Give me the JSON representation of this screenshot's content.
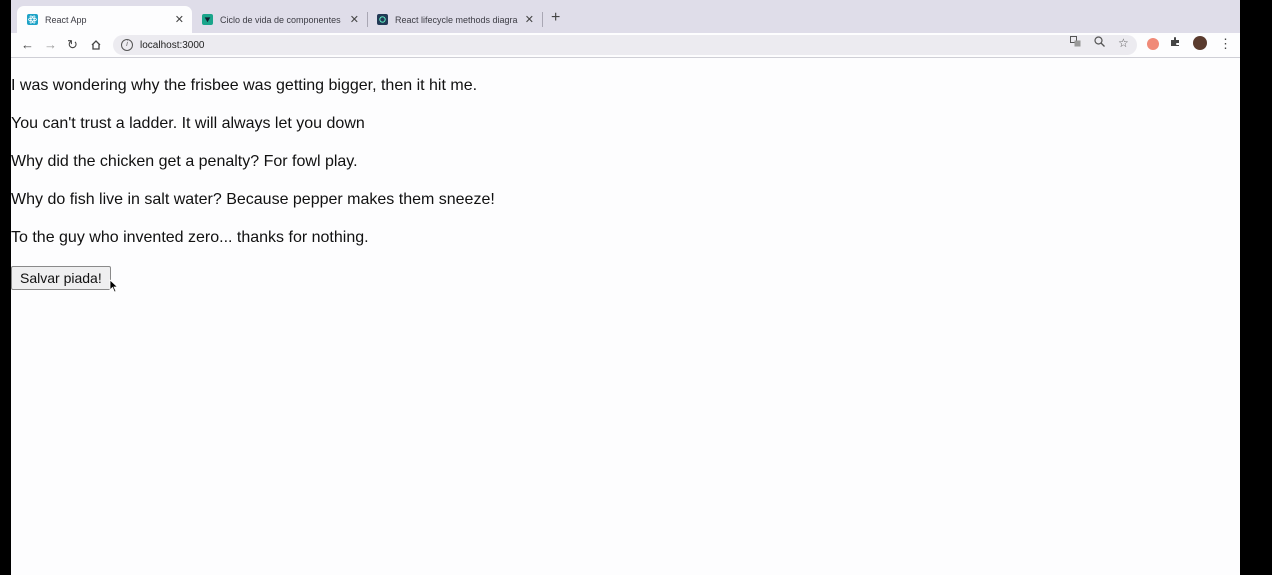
{
  "browser": {
    "tabs": [
      {
        "title": "React App",
        "active": true,
        "favicon_color": "#1fa3c7"
      },
      {
        "title": "Ciclo de vida de componentes",
        "active": false,
        "favicon_color": "#1aa58b"
      },
      {
        "title": "React lifecycle methods diagra",
        "active": false,
        "favicon_color": "#223a56"
      }
    ],
    "url": "localhost:3000"
  },
  "page": {
    "jokes": [
      "I was wondering why the frisbee was getting bigger, then it hit me.",
      "You can't trust a ladder. It will always let you down",
      "Why did the chicken get a penalty? For fowl play.",
      "Why do fish live in salt water? Because pepper makes them sneeze!",
      "To the guy who invented zero... thanks for nothing."
    ],
    "save_button_label": "Salvar piada!"
  }
}
